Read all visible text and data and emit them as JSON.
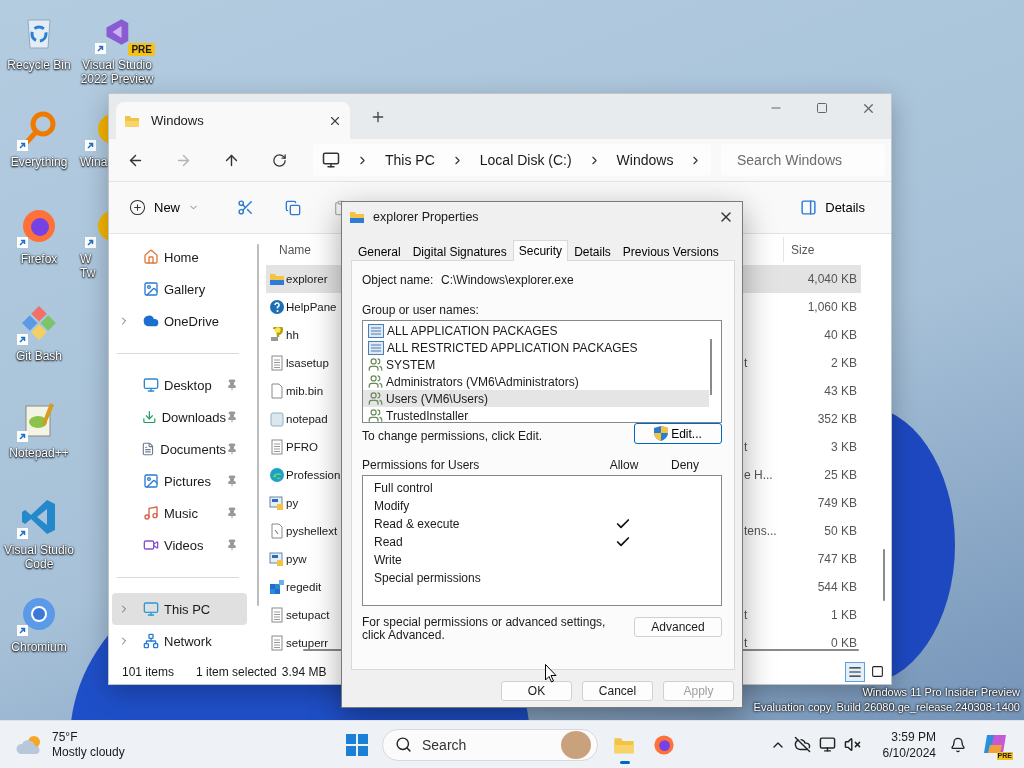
{
  "desktop": {
    "columns": [
      [
        {
          "label": "Recycle Bin",
          "kind": "recycle",
          "shortcut": false
        },
        {
          "label": "Everything",
          "kind": "everything",
          "shortcut": true
        },
        {
          "label": "Firefox",
          "kind": "firefox",
          "shortcut": true
        },
        {
          "label": "Git Bash",
          "kind": "gitbash",
          "shortcut": true
        },
        {
          "label": "Notepad++",
          "kind": "notepadpp",
          "shortcut": true
        },
        {
          "label": "Visual Studio Code",
          "kind": "vscode",
          "shortcut": true
        },
        {
          "label": "Chromium",
          "kind": "chromium",
          "shortcut": true
        }
      ],
      [
        {
          "label": "Visual Studio 2022 Preview",
          "kind": "vs",
          "shortcut": true,
          "badge": "PRE"
        },
        {
          "label": "Wina",
          "kind": "partial",
          "shortcut": true
        },
        {
          "label": "W Tw",
          "kind": "partial",
          "shortcut": true
        }
      ]
    ]
  },
  "explorer": {
    "tab": {
      "title": "Windows"
    },
    "forward_disabled": true,
    "breadcrumb": [
      "This PC",
      "Local Disk (C:)",
      "Windows"
    ],
    "search": {
      "placeholder": "Search Windows"
    },
    "new_button": "New",
    "details_button": "Details",
    "sidebar": {
      "groups": [
        [
          {
            "label": "Home",
            "kind": "home",
            "pinned": false,
            "expandable": false,
            "selected": false
          },
          {
            "label": "Gallery",
            "kind": "gallery",
            "pinned": false,
            "expandable": false,
            "selected": false
          },
          {
            "label": "OneDrive",
            "kind": "onedrive",
            "pinned": false,
            "expandable": true,
            "selected": false
          }
        ],
        [
          {
            "label": "Desktop",
            "kind": "desktop",
            "pinned": true,
            "expandable": false,
            "selected": false
          },
          {
            "label": "Downloads",
            "kind": "downloads",
            "pinned": true,
            "expandable": false,
            "selected": false
          },
          {
            "label": "Documents",
            "kind": "documents",
            "pinned": true,
            "expandable": false,
            "selected": false
          },
          {
            "label": "Pictures",
            "kind": "pictures",
            "pinned": true,
            "expandable": false,
            "selected": false
          },
          {
            "label": "Music",
            "kind": "music",
            "pinned": true,
            "expandable": false,
            "selected": false
          },
          {
            "label": "Videos",
            "kind": "videos",
            "pinned": true,
            "expandable": false,
            "selected": false
          }
        ],
        [
          {
            "label": "This PC",
            "kind": "thispc",
            "pinned": false,
            "expandable": true,
            "selected": true
          },
          {
            "label": "Network",
            "kind": "network",
            "pinned": false,
            "expandable": true,
            "selected": false
          }
        ]
      ]
    },
    "columns": {
      "name": "Name",
      "size": "Size"
    },
    "files": [
      {
        "name": "explorer",
        "kind": "appfolder",
        "size": "4,040 KB",
        "selected": true
      },
      {
        "name": "HelpPane",
        "kind": "help",
        "size": "1,060 KB",
        "selected": false
      },
      {
        "name": "hh",
        "kind": "hh",
        "size": "40 KB",
        "selected": false
      },
      {
        "name": "lsasetup",
        "kind": "text",
        "type": "t",
        "size": "2 KB",
        "selected": false
      },
      {
        "name": "mib.bin",
        "kind": "blank",
        "size": "43 KB",
        "selected": false
      },
      {
        "name": "notepad",
        "kind": "notepad",
        "size": "352 KB",
        "selected": false
      },
      {
        "name": "PFRO",
        "kind": "text",
        "type": "t",
        "size": "3 KB",
        "selected": false
      },
      {
        "name": "Profession",
        "kind": "edge",
        "type": "e H...",
        "size": "25 KB",
        "selected": false
      },
      {
        "name": "py",
        "kind": "python",
        "size": "749 KB",
        "selected": false
      },
      {
        "name": "pyshellext",
        "kind": "script",
        "type": "tens...",
        "size": "50 KB",
        "selected": false
      },
      {
        "name": "pyw",
        "kind": "python",
        "size": "747 KB",
        "selected": false
      },
      {
        "name": "regedit",
        "kind": "regedit",
        "size": "544 KB",
        "selected": false
      },
      {
        "name": "setupact",
        "kind": "text",
        "type": "t",
        "size": "1 KB",
        "selected": false
      },
      {
        "name": "setuperr",
        "kind": "text",
        "type": "t",
        "size": "0 KB",
        "selected": false
      }
    ],
    "status": {
      "count": "101 items",
      "selection": "1 item selected",
      "size": "3.94 MB"
    },
    "view_modes": [
      {
        "kind": "details",
        "selected": true
      },
      {
        "kind": "tiles",
        "selected": false
      }
    ]
  },
  "dialog": {
    "title": "explorer Properties",
    "tabs": [
      {
        "label": "General",
        "selected": false
      },
      {
        "label": "Digital Signatures",
        "selected": false
      },
      {
        "label": "Security",
        "selected": true
      },
      {
        "label": "Details",
        "selected": false
      },
      {
        "label": "Previous Versions",
        "selected": false
      }
    ],
    "object_name_label": "Object name:",
    "object_name": "C:\\Windows\\explorer.exe",
    "groups_label": "Group or user names:",
    "groups": [
      {
        "name": "ALL APPLICATION PACKAGES",
        "kind": "package",
        "selected": false
      },
      {
        "name": "ALL RESTRICTED APPLICATION PACKAGES",
        "kind": "package",
        "selected": false
      },
      {
        "name": "SYSTEM",
        "kind": "users",
        "selected": false
      },
      {
        "name": "Administrators (VM6\\Administrators)",
        "kind": "users",
        "selected": false
      },
      {
        "name": "Users (VM6\\Users)",
        "kind": "users",
        "selected": true
      },
      {
        "name": "TrustedInstaller",
        "kind": "users",
        "selected": false
      }
    ],
    "change_hint": "To change permissions, click Edit.",
    "edit_button": "Edit...",
    "permissions_label": "Permissions for Users",
    "allow_label": "Allow",
    "deny_label": "Deny",
    "permissions": [
      {
        "name": "Full control",
        "allow": false
      },
      {
        "name": "Modify",
        "allow": false
      },
      {
        "name": "Read & execute",
        "allow": true
      },
      {
        "name": "Read",
        "allow": true
      },
      {
        "name": "Write",
        "allow": false
      },
      {
        "name": "Special permissions",
        "allow": false
      }
    ],
    "advanced_hint": "For special permissions or advanced settings, click Advanced.",
    "advanced_button": "Advanced",
    "buttons": [
      {
        "label": "OK",
        "disabled": false
      },
      {
        "label": "Cancel",
        "disabled": false
      },
      {
        "label": "Apply",
        "disabled": true
      }
    ]
  },
  "taskbar": {
    "weather": {
      "temperature": "75°F",
      "condition": "Mostly cloudy"
    },
    "search": {
      "label": "Search"
    },
    "apps": [
      {
        "kind": "explorer",
        "active": true
      },
      {
        "kind": "firefox",
        "active": false
      }
    ],
    "clock": {
      "time": "3:59 PM",
      "date": "6/10/2024"
    },
    "copilot_badge": "PRE"
  },
  "watermark": {
    "line_1": "Windows 11 Pro Insider Preview",
    "line_2": "Evaluation copy. Build 26080.ge_release.240308-1400"
  }
}
